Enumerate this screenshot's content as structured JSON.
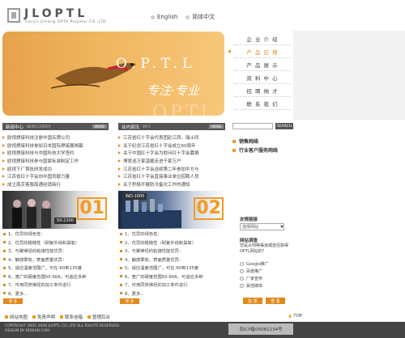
{
  "header": {
    "logo": "JLOPTL",
    "company": "Tianjin Jinlong OPTA Polymer CO.,LTD",
    "lang_en": "English",
    "lang_cn": "简体中文"
  },
  "banner": {
    "brand": "O.P.T.L",
    "slogan": "专注·专业",
    "ghost": "OPTL"
  },
  "nav": {
    "items": [
      "企 业 介 绍",
      "产 品 应 用",
      "产 品 展 示",
      "资 料 中 心",
      "招 聘 纳 才",
      "联 系 我 们"
    ],
    "active_index": 1
  },
  "news": {
    "title": "新闻中心",
    "title_en": "NEWS CENTER",
    "more": "MORE",
    "items": [
      "欧视焊接科技注册中国名牌公司",
      "欧视焊接科技参加日本国际焊接展揭幕",
      "欧视焊接科技与中国科技大学签约",
      "欧视焊接科技参与国家标准制定工作",
      "欧视下厂首批研发成功",
      "江苏省红十字会向中国贡献力量",
      "成立南京客服南通经销商行"
    ],
    "photo_caption": "SX-2100",
    "photo_num": "01"
  },
  "industry": {
    "title": "业内资讯",
    "title_en": "INFO",
    "more": "MORE",
    "items": [
      "江苏省红十字会代表团赴江西，瑞士同",
      "关于纪念江苏省红十字会成立60周年",
      "关于中国红十字会为慰问红十字会募捐",
      "博爱送万家温暖走进千家万户",
      "江苏省红十字会连续第二年参加中方与",
      "江苏省红十字会直接事业单位招聘人员",
      "关于积极开展防汛备灾工作的通知"
    ],
    "photo_caption": "WD-1005",
    "photo_num": "02"
  },
  "features_left": {
    "items": [
      "1、优异的绿色性：",
      "2、优异的粗糙性（耐紫外线和臭氧）",
      "3、与聚烯烃的粘接性能优异：",
      "4、触感柔软，表面质量优异：",
      "5、适应温度范围广，可在-60到135度",
      "6、宽广的硬度范围50-90A，可适应多种",
      "7、可用同类烯烃的加工条件进行",
      "8、更多..."
    ],
    "more": "更 多"
  },
  "features_right": {
    "items": [
      "1、优异的绿色性：",
      "2、优异的粗糙性（耐紫外线和臭氧）",
      "3、与聚烯烃的粘接性能优异：",
      "4、触感柔软，表面质量优异：",
      "5、适应温度范围广，可在-60到135度",
      "6、宽广的硬度范围50-90A，可适应多种",
      "7、可用同类烯烃的加工条件进行",
      "8、更多..."
    ],
    "more": "更 多"
  },
  "search": {
    "button": "SEARCH",
    "placeholder": ""
  },
  "quick": {
    "items": [
      "销售网络",
      "行业客户服务网络"
    ]
  },
  "links": {
    "title": "友情链接",
    "selected": "选择网站"
  },
  "survey": {
    "title": "网站调查",
    "question": "您是从何种渠道或途径获得OPTL网站的？",
    "options": [
      "Google推广",
      "百度推广",
      "厂家宣传",
      "其他媒体"
    ],
    "vote": "投 票",
    "view": "查 看"
  },
  "footer": {
    "links": [
      "网站地图",
      "免责声明",
      "联系信箱",
      "管理后台"
    ],
    "top": "TOP",
    "copyright1": "COPYRIGHT 2005-2008 JLOPTL CO.,LTD ALL RIGHTS RESERVED.",
    "copyright2": "DESIGN BY BOXIAN.COM",
    "icp": "苏ICP备05081234号"
  }
}
